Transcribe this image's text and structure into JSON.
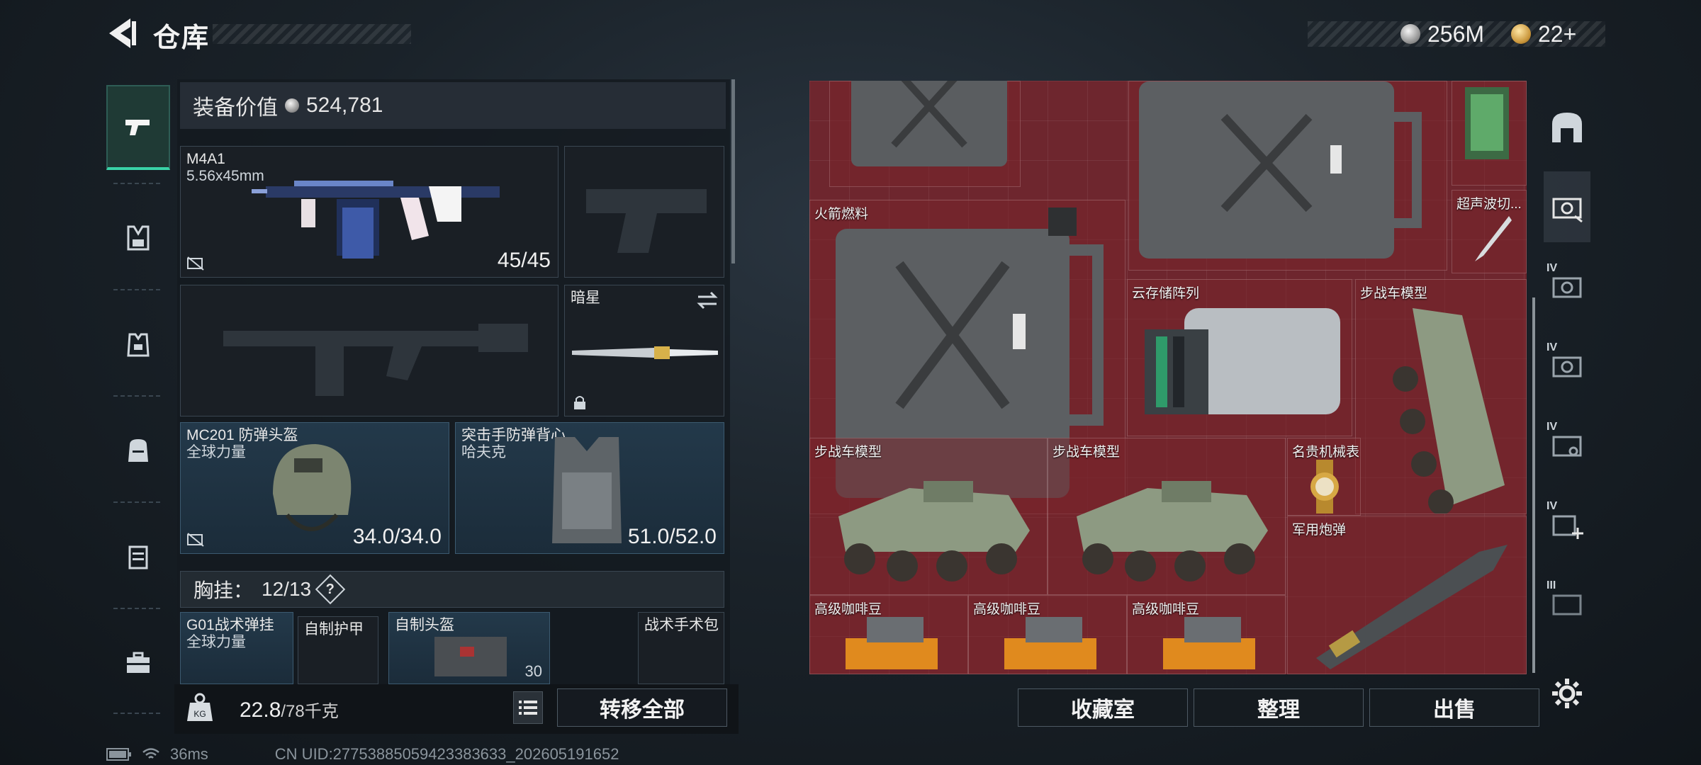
{
  "header": {
    "title": "仓库"
  },
  "currency": [
    {
      "name": "silver-coin",
      "amount": "256M",
      "color": "#c8c8c8"
    },
    {
      "name": "gold-coin",
      "amount": "22+",
      "color": "#d1a045"
    }
  ],
  "left_nav": [
    "pistol-icon",
    "backpack-rig-icon",
    "vest-icon",
    "bag-icon",
    "case-icon",
    "toolbox-icon"
  ],
  "equipment": {
    "value_label": "装备价值",
    "value": "524,781",
    "primary": {
      "name": "M4A1",
      "ammo": "5.56x45mm",
      "count": "45/45"
    },
    "helmet": {
      "name": "MC201 防弹头盔",
      "brand": "全球力量",
      "durability": "34.0/34.0"
    },
    "armor": {
      "name": "突击手防弹背心",
      "brand": "哈夫克",
      "durability": "51.0/52.0"
    },
    "melee": {
      "name": "暗星"
    },
    "chest": {
      "label": "胸挂：",
      "count": "12/13",
      "help": "?"
    },
    "chest_items": [
      {
        "name": "G01战术弹挂",
        "brand": "全球力量"
      },
      {
        "name": "自制护甲"
      },
      {
        "name": "自制头盔",
        "count": "30"
      },
      {
        "name": "战术手术包"
      }
    ]
  },
  "weight": {
    "current": "22.8",
    "capacity": "/78千克"
  },
  "buttons": {
    "transfer_all": "转移全部",
    "collection": "收藏室",
    "sort": "整理",
    "sell": "出售"
  },
  "stash_items": [
    {
      "label": "火箭燃料"
    },
    {
      "label": "超声波切..."
    },
    {
      "label": "云存储阵列"
    },
    {
      "label": "步战车模型"
    },
    {
      "label": "步战车模型"
    },
    {
      "label": "步战车模型"
    },
    {
      "label": "名贵机械表"
    },
    {
      "label": "军用炮弹"
    },
    {
      "label": "高级咖啡豆"
    },
    {
      "label": "高级咖啡豆"
    },
    {
      "label": "高级咖啡豆"
    }
  ],
  "right_nav": [
    {
      "icon": "vault-icon",
      "tier": ""
    },
    {
      "icon": "stash-tab-icon",
      "tier": ""
    },
    {
      "icon": "stash-tab-icon",
      "tier": "IV"
    },
    {
      "icon": "stash-tab-icon",
      "tier": "IV"
    },
    {
      "icon": "stash-tab-icon",
      "tier": "IV"
    },
    {
      "icon": "stash-add-icon",
      "tier": "IV"
    },
    {
      "icon": "stash-tab-icon",
      "tier": "III"
    }
  ],
  "status": {
    "ping": "36ms",
    "uid": "CN UID:27753885059423383633_202605191652"
  }
}
